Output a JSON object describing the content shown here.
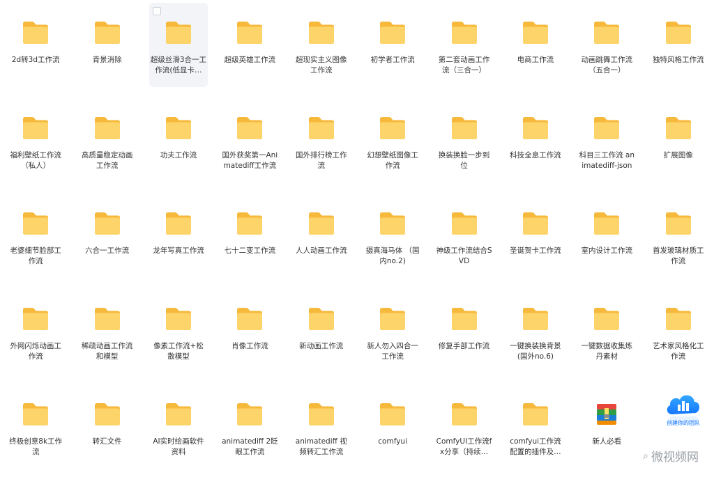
{
  "grid": {
    "items": [
      {
        "label": "2d转3d工作流",
        "type": "folder"
      },
      {
        "label": "背景消除",
        "type": "folder"
      },
      {
        "label": "超级丝滑3合一工作流(低显卡…",
        "type": "folder",
        "selected": true
      },
      {
        "label": "超级英雄工作流",
        "type": "folder"
      },
      {
        "label": "超现实主义图像工作流",
        "type": "folder"
      },
      {
        "label": "初学者工作流",
        "type": "folder"
      },
      {
        "label": "第二套动画工作流（三合一）",
        "type": "folder"
      },
      {
        "label": "电商工作流",
        "type": "folder"
      },
      {
        "label": "动画跳舞工作流（五合一）",
        "type": "folder"
      },
      {
        "label": "独特风格工作流",
        "type": "folder"
      },
      {
        "label": "福利壁纸工作流（私人）",
        "type": "folder"
      },
      {
        "label": "高质量稳定动画工作流",
        "type": "folder"
      },
      {
        "label": "功夫工作流",
        "type": "folder"
      },
      {
        "label": "国外获奖第一Animatediff工作流",
        "type": "folder"
      },
      {
        "label": "国外排行榜工作流",
        "type": "folder"
      },
      {
        "label": "幻想壁纸图像工作流",
        "type": "folder"
      },
      {
        "label": "换装换脸一步到位",
        "type": "folder"
      },
      {
        "label": "科技全息工作流",
        "type": "folder"
      },
      {
        "label": "科目三工作流 animatediff-json",
        "type": "folder"
      },
      {
        "label": "扩展图像",
        "type": "folder"
      },
      {
        "label": "老婆细节脸部工作流",
        "type": "folder"
      },
      {
        "label": "六合一工作流",
        "type": "folder"
      },
      {
        "label": "龙年写真工作流",
        "type": "folder"
      },
      {
        "label": "七十二变工作流",
        "type": "folder"
      },
      {
        "label": "人人动画工作流",
        "type": "folder"
      },
      {
        "label": "摄真海马体 （国内no.2)",
        "type": "folder"
      },
      {
        "label": "神级工作流结合SVD",
        "type": "folder"
      },
      {
        "label": "圣诞贺卡工作流",
        "type": "folder"
      },
      {
        "label": "室内设计工作流",
        "type": "folder"
      },
      {
        "label": "首发玻璃材质工作流",
        "type": "folder"
      },
      {
        "label": "外网闪烁动画工作流",
        "type": "folder"
      },
      {
        "label": "稀疏动画工作流和模型",
        "type": "folder"
      },
      {
        "label": "像素工作流+松散模型",
        "type": "folder"
      },
      {
        "label": "肖像工作流",
        "type": "folder"
      },
      {
        "label": "新动画工作流",
        "type": "folder"
      },
      {
        "label": "新人勿入四合一工作流",
        "type": "folder"
      },
      {
        "label": "修复手部工作流",
        "type": "folder"
      },
      {
        "label": "一键换装换背景(国外no.6)",
        "type": "folder"
      },
      {
        "label": "一键数据收集炼丹素材",
        "type": "folder"
      },
      {
        "label": "艺术家风格化工作流",
        "type": "folder"
      },
      {
        "label": "终极创意8k工作流",
        "type": "folder"
      },
      {
        "label": "转汇文件",
        "type": "folder"
      },
      {
        "label": "AI实时绘画软件资料",
        "type": "folder"
      },
      {
        "label": "animatediff 2眨眼工作流",
        "type": "folder"
      },
      {
        "label": "animatediff 视频转汇工作流",
        "type": "folder"
      },
      {
        "label": "comfyui",
        "type": "folder"
      },
      {
        "label": "ComfyUI工作流fx分享（持续…",
        "type": "folder"
      },
      {
        "label": "comfyui工作流配置的插件及…",
        "type": "folder"
      },
      {
        "label": "新人必看",
        "type": "archive"
      },
      {
        "label": "",
        "type": "hidden"
      }
    ]
  },
  "watermark": {
    "text": "微视频网",
    "glyph": "⌕"
  },
  "badge": {
    "text": "创建你的团队"
  },
  "colors": {
    "folder_back": "#f6b93b",
    "folder_front": "#fdd469",
    "label": "#333333",
    "accent": "#1677ff"
  }
}
